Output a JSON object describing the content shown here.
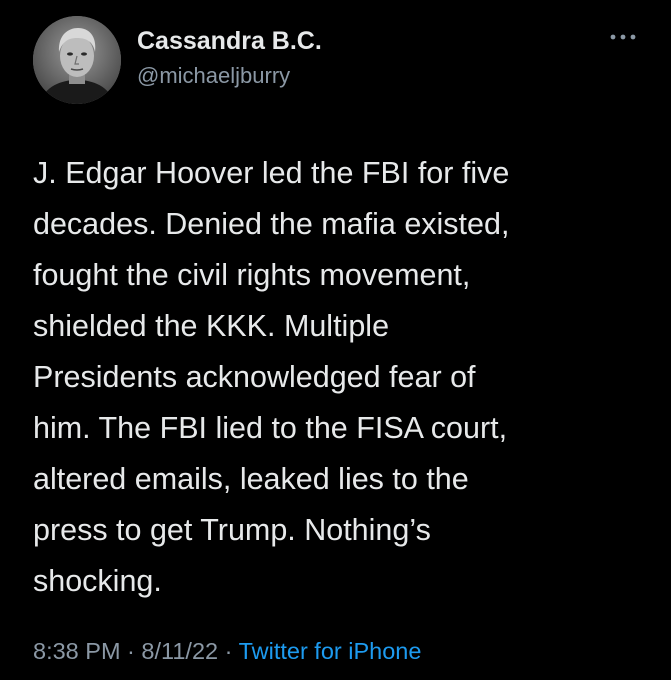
{
  "tweet": {
    "display_name": "Cassandra B.C.",
    "handle": "@michaeljburry",
    "more_icon": "more-horizontal-icon",
    "text": "J. Edgar Hoover led the FBI for five\ndecades. Denied the mafia existed,\nfought the civil rights movement,\nshielded the KKK. Multiple\nPresidents acknowledged fear of\nhim. The FBI lied to the FISA court,\naltered emails, leaked lies to the\npress to get Trump. Nothing’s\nshocking.",
    "time": "8:38 PM",
    "sep1": " · ",
    "date": "8/11/22",
    "sep2": " · ",
    "source": "Twitter for iPhone"
  },
  "colors": {
    "background": "#000000",
    "primary_text": "#e7e9ea",
    "secondary_text": "#8b98a5",
    "link": "#1d9bf0"
  }
}
